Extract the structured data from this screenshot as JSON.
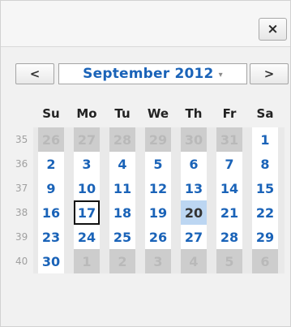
{
  "close_label": "×",
  "header": {
    "prev_label": "<",
    "next_label": ">",
    "month_label": "September 2012",
    "caret": "▾"
  },
  "days_of_week": [
    "Su",
    "Mo",
    "Tu",
    "We",
    "Th",
    "Fr",
    "Sa"
  ],
  "weeks": [
    {
      "num": "35",
      "days": [
        {
          "d": "26",
          "cls": "other"
        },
        {
          "d": "27",
          "cls": "other"
        },
        {
          "d": "28",
          "cls": "other"
        },
        {
          "d": "29",
          "cls": "other"
        },
        {
          "d": "30",
          "cls": "other"
        },
        {
          "d": "31",
          "cls": "other"
        },
        {
          "d": "1",
          "cls": ""
        }
      ]
    },
    {
      "num": "36",
      "days": [
        {
          "d": "2",
          "cls": ""
        },
        {
          "d": "3",
          "cls": ""
        },
        {
          "d": "4",
          "cls": ""
        },
        {
          "d": "5",
          "cls": ""
        },
        {
          "d": "6",
          "cls": ""
        },
        {
          "d": "7",
          "cls": ""
        },
        {
          "d": "8",
          "cls": ""
        }
      ]
    },
    {
      "num": "37",
      "days": [
        {
          "d": "9",
          "cls": ""
        },
        {
          "d": "10",
          "cls": ""
        },
        {
          "d": "11",
          "cls": ""
        },
        {
          "d": "12",
          "cls": ""
        },
        {
          "d": "13",
          "cls": ""
        },
        {
          "d": "14",
          "cls": ""
        },
        {
          "d": "15",
          "cls": ""
        }
      ]
    },
    {
      "num": "38",
      "days": [
        {
          "d": "16",
          "cls": ""
        },
        {
          "d": "17",
          "cls": "selected"
        },
        {
          "d": "18",
          "cls": ""
        },
        {
          "d": "19",
          "cls": ""
        },
        {
          "d": "20",
          "cls": "today"
        },
        {
          "d": "21",
          "cls": ""
        },
        {
          "d": "22",
          "cls": ""
        }
      ]
    },
    {
      "num": "39",
      "days": [
        {
          "d": "23",
          "cls": ""
        },
        {
          "d": "24",
          "cls": ""
        },
        {
          "d": "25",
          "cls": ""
        },
        {
          "d": "26",
          "cls": ""
        },
        {
          "d": "27",
          "cls": ""
        },
        {
          "d": "28",
          "cls": ""
        },
        {
          "d": "29",
          "cls": ""
        }
      ]
    },
    {
      "num": "40",
      "days": [
        {
          "d": "30",
          "cls": ""
        },
        {
          "d": "1",
          "cls": "other"
        },
        {
          "d": "2",
          "cls": "other"
        },
        {
          "d": "3",
          "cls": "other"
        },
        {
          "d": "4",
          "cls": "other"
        },
        {
          "d": "5",
          "cls": "other"
        },
        {
          "d": "6",
          "cls": "other"
        }
      ]
    }
  ],
  "colors": {
    "accent": "#1a63b8",
    "other_month_bg": "#cdcdcd",
    "today_bg": "#bcd6f2"
  }
}
